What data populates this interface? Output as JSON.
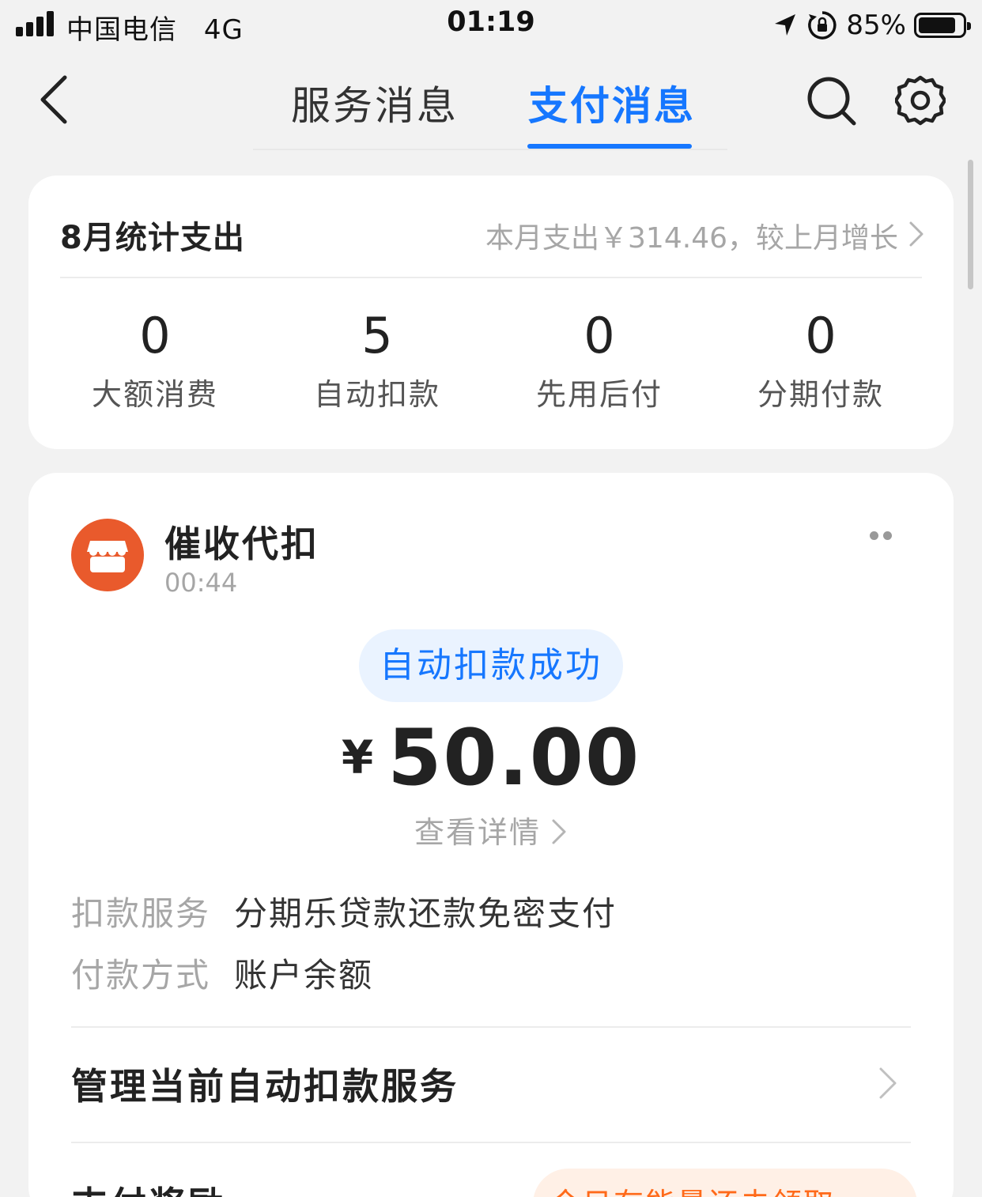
{
  "status_bar": {
    "carrier": "中国电信",
    "network": "4G",
    "time": "01:19",
    "battery_percent": "85%"
  },
  "nav": {
    "tabs": [
      {
        "label": "服务消息",
        "active": false
      },
      {
        "label": "支付消息",
        "active": true
      }
    ],
    "active_color": "#1677ff"
  },
  "monthly_stats": {
    "title": "8月统计支出",
    "summary": "本月支出￥314.46，较上月增长",
    "items": [
      {
        "value": "0",
        "label": "大额消费"
      },
      {
        "value": "5",
        "label": "自动扣款"
      },
      {
        "value": "0",
        "label": "先用后付"
      },
      {
        "value": "0",
        "label": "分期付款"
      }
    ]
  },
  "message": {
    "merchant_name": "催收代扣",
    "time": "00:44",
    "status": "自动扣款成功",
    "currency": "¥",
    "amount": "50.00",
    "details_link": "查看详情",
    "info": [
      {
        "label": "扣款服务",
        "value": "分期乐贷款还款免密支付"
      },
      {
        "label": "付款方式",
        "value": "账户余额"
      }
    ],
    "manage_label": "管理当前自动扣款服务",
    "reward_label": "支付奖励",
    "reward_action": "今日有能量还未领取",
    "avatar_color": "#e95a2c"
  }
}
